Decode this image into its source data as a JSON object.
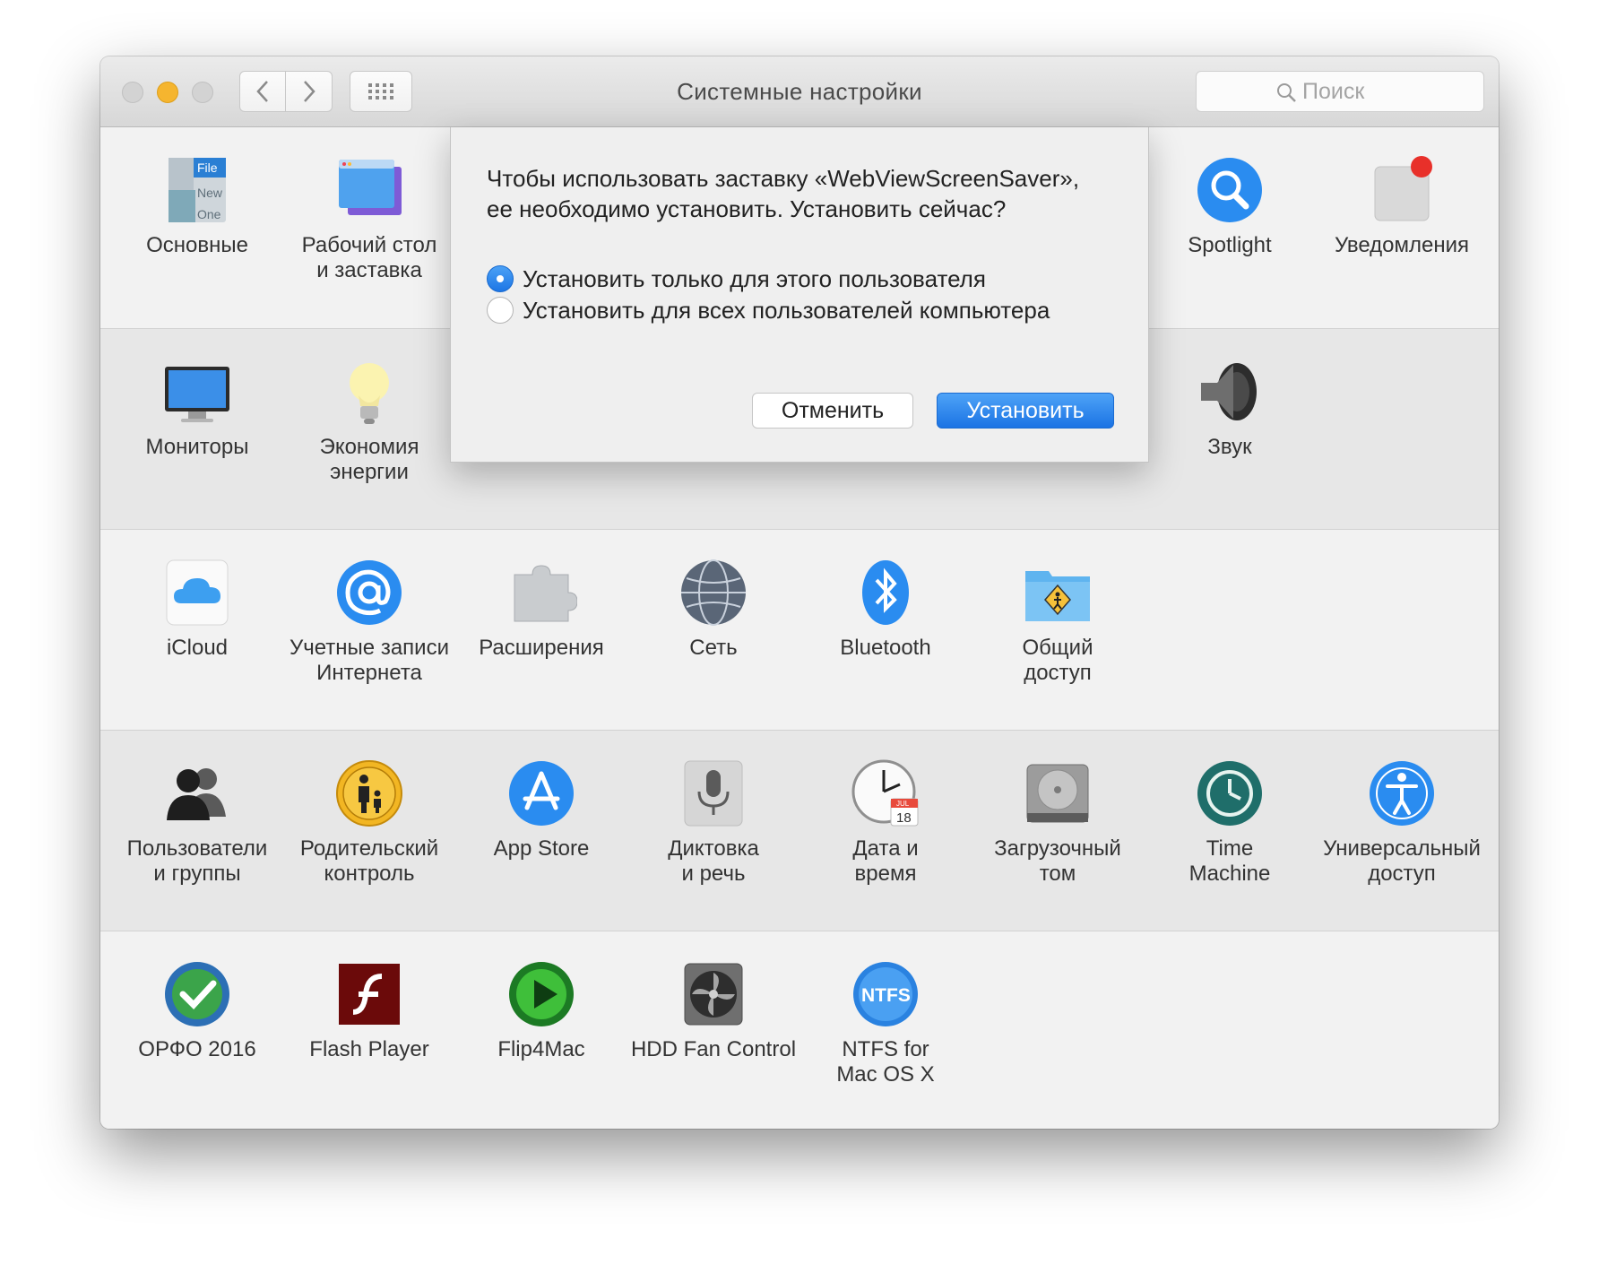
{
  "window": {
    "title": "Системные настройки"
  },
  "search": {
    "placeholder": "Поиск"
  },
  "rows": {
    "r1": [
      {
        "label": "Основные",
        "icon": "general-icon"
      },
      {
        "label": "Рабочий стол\nи заставка",
        "icon": "desktop-screensaver-icon"
      },
      {
        "label": "Spotlight",
        "icon": "spotlight-icon"
      },
      {
        "label": "Уведомления",
        "icon": "notifications-icon"
      }
    ],
    "r2": [
      {
        "label": "Мониторы",
        "icon": "displays-icon"
      },
      {
        "label": "Экономия\nэнергии",
        "icon": "energy-saver-icon"
      },
      {
        "label": "Звук",
        "icon": "sound-icon"
      }
    ],
    "r3": [
      {
        "label": "iCloud",
        "icon": "icloud-icon"
      },
      {
        "label": "Учетные записи\nИнтернета",
        "icon": "internet-accounts-icon"
      },
      {
        "label": "Расширения",
        "icon": "extensions-icon"
      },
      {
        "label": "Сеть",
        "icon": "network-icon"
      },
      {
        "label": "Bluetooth",
        "icon": "bluetooth-icon"
      },
      {
        "label": "Общий\nдоступ",
        "icon": "sharing-icon"
      }
    ],
    "r4": [
      {
        "label": "Пользователи\nи группы",
        "icon": "users-groups-icon"
      },
      {
        "label": "Родительский\nконтроль",
        "icon": "parental-controls-icon"
      },
      {
        "label": "App Store",
        "icon": "app-store-icon"
      },
      {
        "label": "Диктовка\nи речь",
        "icon": "dictation-icon"
      },
      {
        "label": "Дата и\nвремя",
        "icon": "date-time-icon"
      },
      {
        "label": "Загрузочный\nтом",
        "icon": "startup-disk-icon"
      },
      {
        "label": "Time\nMachine",
        "icon": "time-machine-icon"
      },
      {
        "label": "Универсальный\nдоступ",
        "icon": "accessibility-icon"
      }
    ],
    "r5": [
      {
        "label": "ОРФО 2016",
        "icon": "orfo-icon"
      },
      {
        "label": "Flash Player",
        "icon": "flash-player-icon"
      },
      {
        "label": "Flip4Mac",
        "icon": "flip4mac-icon"
      },
      {
        "label": "HDD Fan Control",
        "icon": "hdd-fan-control-icon"
      },
      {
        "label": "NTFS for\nMac OS X",
        "icon": "ntfs-icon"
      }
    ]
  },
  "dialog": {
    "message_line1": "Чтобы использовать заставку «WebViewScreenSaver»,",
    "message_line2": "ее необходимо установить. Установить сейчас?",
    "options": [
      {
        "label": "Установить только для этого пользователя",
        "selected": true
      },
      {
        "label": "Установить для всех пользователей компьютера",
        "selected": false
      }
    ],
    "cancel_label": "Отменить",
    "install_label": "Установить"
  },
  "icon_texts": {
    "file": "File",
    "new": "New",
    "one": "One",
    "ntfs": "NTFS",
    "cal_month": "JUL",
    "cal_day": "18"
  },
  "colors": {
    "accent": "#1d76e5",
    "close": "#d3d3d3",
    "minimize": "#f5b52f",
    "notification_badge": "#e8302a"
  }
}
